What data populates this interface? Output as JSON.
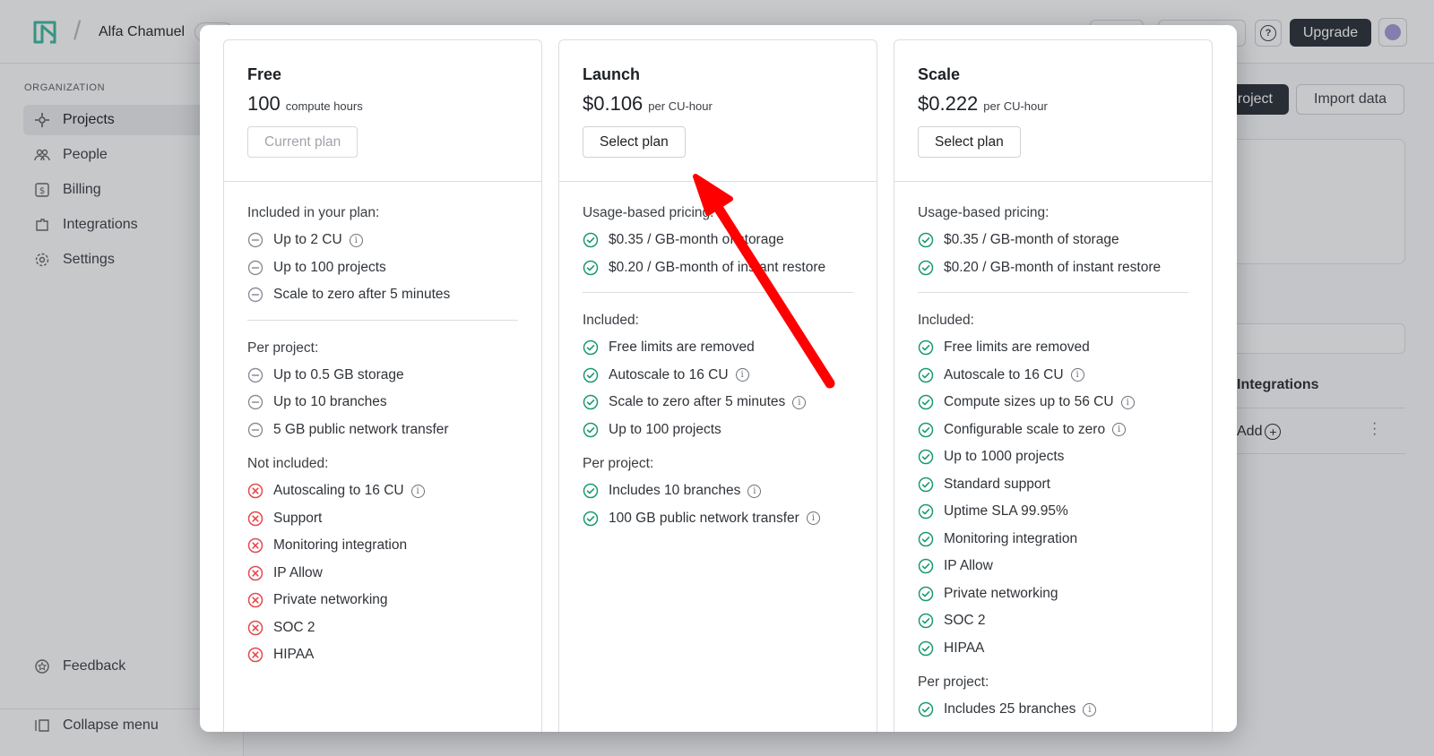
{
  "app": {
    "org_name": "Alfa Chamuel",
    "upgrade_label": "Upgrade",
    "help_icon": "help-circle-icon",
    "sidebar": {
      "heading": "ORGANIZATION",
      "items": [
        {
          "label": "Projects",
          "icon": "projects-icon",
          "active": true
        },
        {
          "label": "People",
          "icon": "people-icon",
          "active": false
        },
        {
          "label": "Billing",
          "icon": "billing-icon",
          "active": false
        },
        {
          "label": "Integrations",
          "icon": "integrations-icon",
          "active": false
        },
        {
          "label": "Settings",
          "icon": "settings-icon",
          "active": false
        }
      ],
      "feedback_label": "Feedback",
      "collapse_label": "Collapse menu"
    },
    "main": {
      "new_project_partial": "roject",
      "import_label": "Import data",
      "integrations_title": "Integrations",
      "add_label": "Add"
    },
    "colors": {
      "accent_green": "#1a9b6b",
      "error_red": "#e5484d",
      "dark_button": "#2b2f36",
      "annotation_arrow": "#ff0000"
    }
  },
  "plans": [
    {
      "name": "Free",
      "price": "100",
      "price_unit": "compute hours",
      "button_label": "Current plan",
      "button_disabled": true,
      "sections": [
        {
          "title": "Included in your plan:",
          "icon": "minus-circle-icon",
          "features": [
            {
              "text": "Up to 2 CU",
              "info": true
            },
            {
              "text": "Up to 100 projects",
              "info": false
            },
            {
              "text": "Scale to zero after 5 minutes",
              "info": false
            }
          ],
          "divider_after": true
        },
        {
          "title": "Per project:",
          "icon": "minus-circle-icon",
          "features": [
            {
              "text": "Up to 0.5 GB storage",
              "info": false
            },
            {
              "text": "Up to 10 branches",
              "info": false
            },
            {
              "text": "5 GB public network transfer",
              "info": false
            }
          ]
        },
        {
          "title": "Not included:",
          "icon": "x-circle-icon",
          "features": [
            {
              "text": "Autoscaling to 16 CU",
              "info": true
            },
            {
              "text": "Support",
              "info": false
            },
            {
              "text": "Monitoring integration",
              "info": false
            },
            {
              "text": "IP Allow",
              "info": false
            },
            {
              "text": "Private networking",
              "info": false
            },
            {
              "text": "SOC 2",
              "info": false
            },
            {
              "text": "HIPAA",
              "info": false
            }
          ]
        }
      ]
    },
    {
      "name": "Launch",
      "price": "$0.106",
      "price_unit": "per CU-hour",
      "button_label": "Select plan",
      "button_disabled": false,
      "sections": [
        {
          "title": "Usage-based pricing:",
          "icon": "check-circle-icon",
          "features": [
            {
              "text": "$0.35 / GB-month of storage",
              "info": false
            },
            {
              "text": "$0.20 / GB-month of instant restore",
              "info": false
            }
          ],
          "divider_after": true
        },
        {
          "title": "Included:",
          "icon": "check-circle-icon",
          "features": [
            {
              "text": "Free limits are removed",
              "info": false
            },
            {
              "text": "Autoscale to 16 CU",
              "info": true
            },
            {
              "text": "Scale to zero after 5 minutes",
              "info": true
            },
            {
              "text": "Up to 100 projects",
              "info": false
            }
          ]
        },
        {
          "title": "Per project:",
          "icon": "check-circle-icon",
          "features": [
            {
              "text": "Includes 10 branches",
              "info": true
            },
            {
              "text": "100 GB public network transfer",
              "info": true
            }
          ]
        }
      ]
    },
    {
      "name": "Scale",
      "price": "$0.222",
      "price_unit": "per CU-hour",
      "button_label": "Select plan",
      "button_disabled": false,
      "sections": [
        {
          "title": "Usage-based pricing:",
          "icon": "check-circle-icon",
          "features": [
            {
              "text": "$0.35 / GB-month of storage",
              "info": false
            },
            {
              "text": "$0.20 / GB-month of instant restore",
              "info": false
            }
          ],
          "divider_after": true
        },
        {
          "title": "Included:",
          "icon": "check-circle-icon",
          "features": [
            {
              "text": "Free limits are removed",
              "info": false
            },
            {
              "text": "Autoscale to 16 CU",
              "info": true
            },
            {
              "text": "Compute sizes up to 56 CU",
              "info": true
            },
            {
              "text": "Configurable scale to zero",
              "info": true
            },
            {
              "text": "Up to 1000 projects",
              "info": false
            },
            {
              "text": "Standard support",
              "info": false
            },
            {
              "text": "Uptime SLA 99.95%",
              "info": false
            },
            {
              "text": "Monitoring integration",
              "info": false
            },
            {
              "text": "IP Allow",
              "info": false
            },
            {
              "text": "Private networking",
              "info": false
            },
            {
              "text": "SOC 2",
              "info": false
            },
            {
              "text": "HIPAA",
              "info": false
            }
          ]
        },
        {
          "title": "Per project:",
          "icon": "check-circle-icon",
          "features": [
            {
              "text": "Includes 25 branches",
              "info": true
            }
          ]
        }
      ]
    }
  ]
}
